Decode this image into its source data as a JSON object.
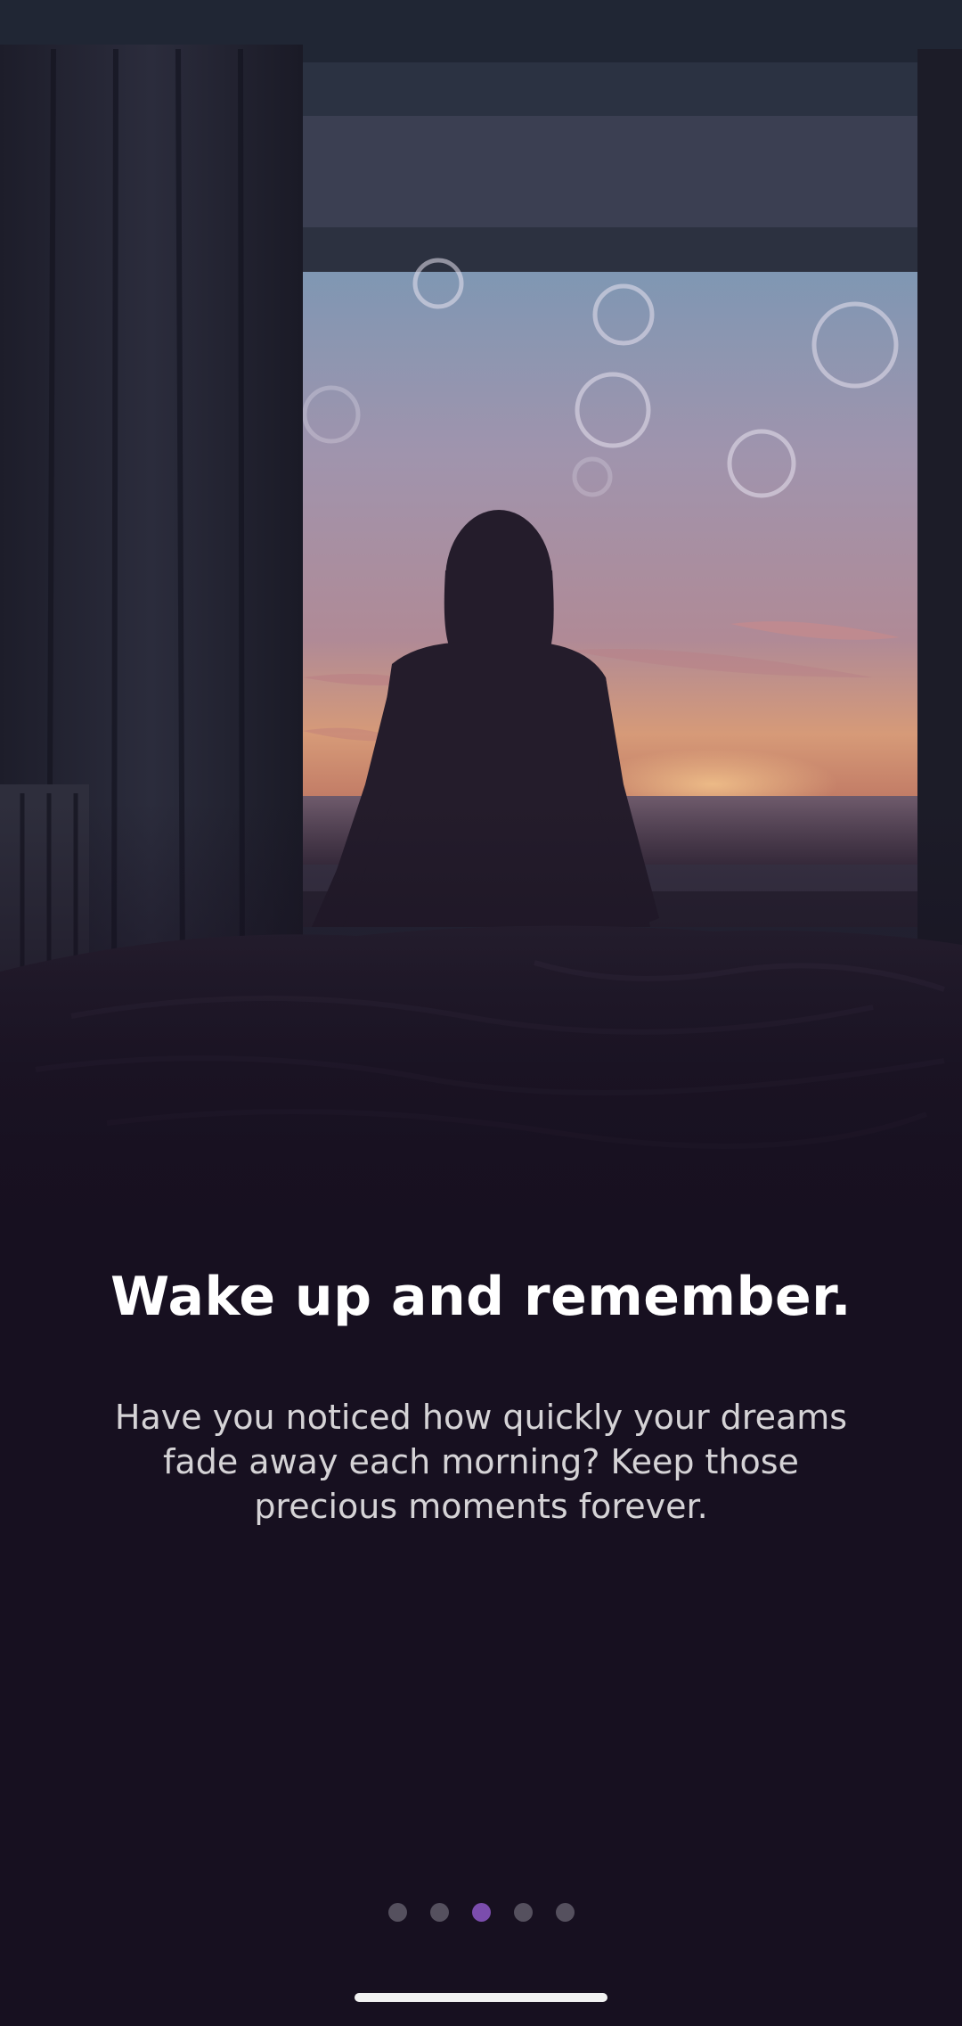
{
  "onboarding": {
    "title": "Wake up and remember.",
    "body": "Have you noticed how quickly your dreams fade away each morning? Keep those precious moments forever."
  },
  "pager": {
    "total_pages": 5,
    "current_page": 3,
    "active_color": "#7b4dad",
    "inactive_color": "#55505e"
  },
  "theme": {
    "background": "#171020"
  },
  "hero_image": {
    "icon": "woman-at-window-illustration"
  }
}
